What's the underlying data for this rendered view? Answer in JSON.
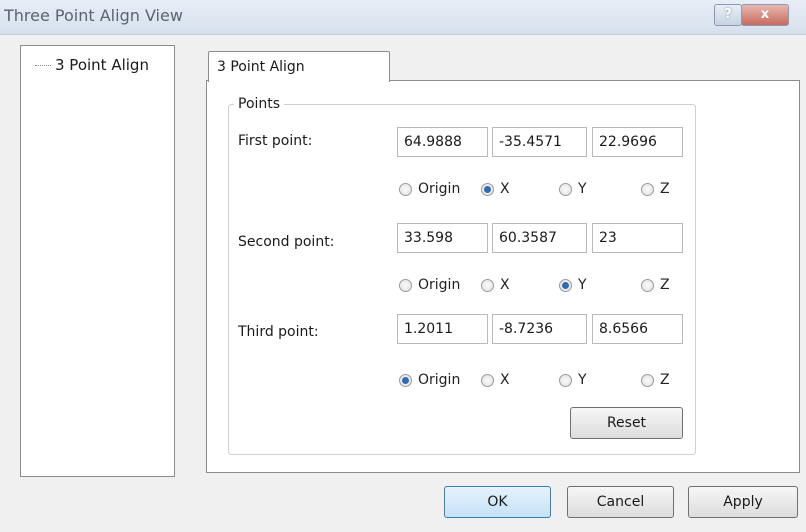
{
  "window": {
    "title": "Three Point Align View",
    "help_label": "?",
    "close_label": "x"
  },
  "tree": {
    "item": "3 Point Align"
  },
  "tab": {
    "label": "3 Point Align"
  },
  "points": {
    "legend": "Points",
    "first": {
      "label": "First point:",
      "x": "64.9888",
      "y": "-35.4571",
      "z": "22.9696",
      "selected_axis": "X"
    },
    "second": {
      "label": "Second point:",
      "x": "33.598",
      "y": "60.3587",
      "z": "23",
      "selected_axis": "Y"
    },
    "third": {
      "label": "Third point:",
      "x": "1.2011",
      "y": "-8.7236",
      "z": "8.6566",
      "selected_axis": "Origin"
    },
    "radio_labels": {
      "origin": "Origin",
      "x": "X",
      "y": "Y",
      "z": "Z"
    },
    "reset_label": "Reset"
  },
  "buttons": {
    "ok": "OK",
    "cancel": "Cancel",
    "apply": "Apply"
  },
  "colors": {
    "radio_selected": "#2f6bb5",
    "ok_border": "#3c7fb1"
  }
}
